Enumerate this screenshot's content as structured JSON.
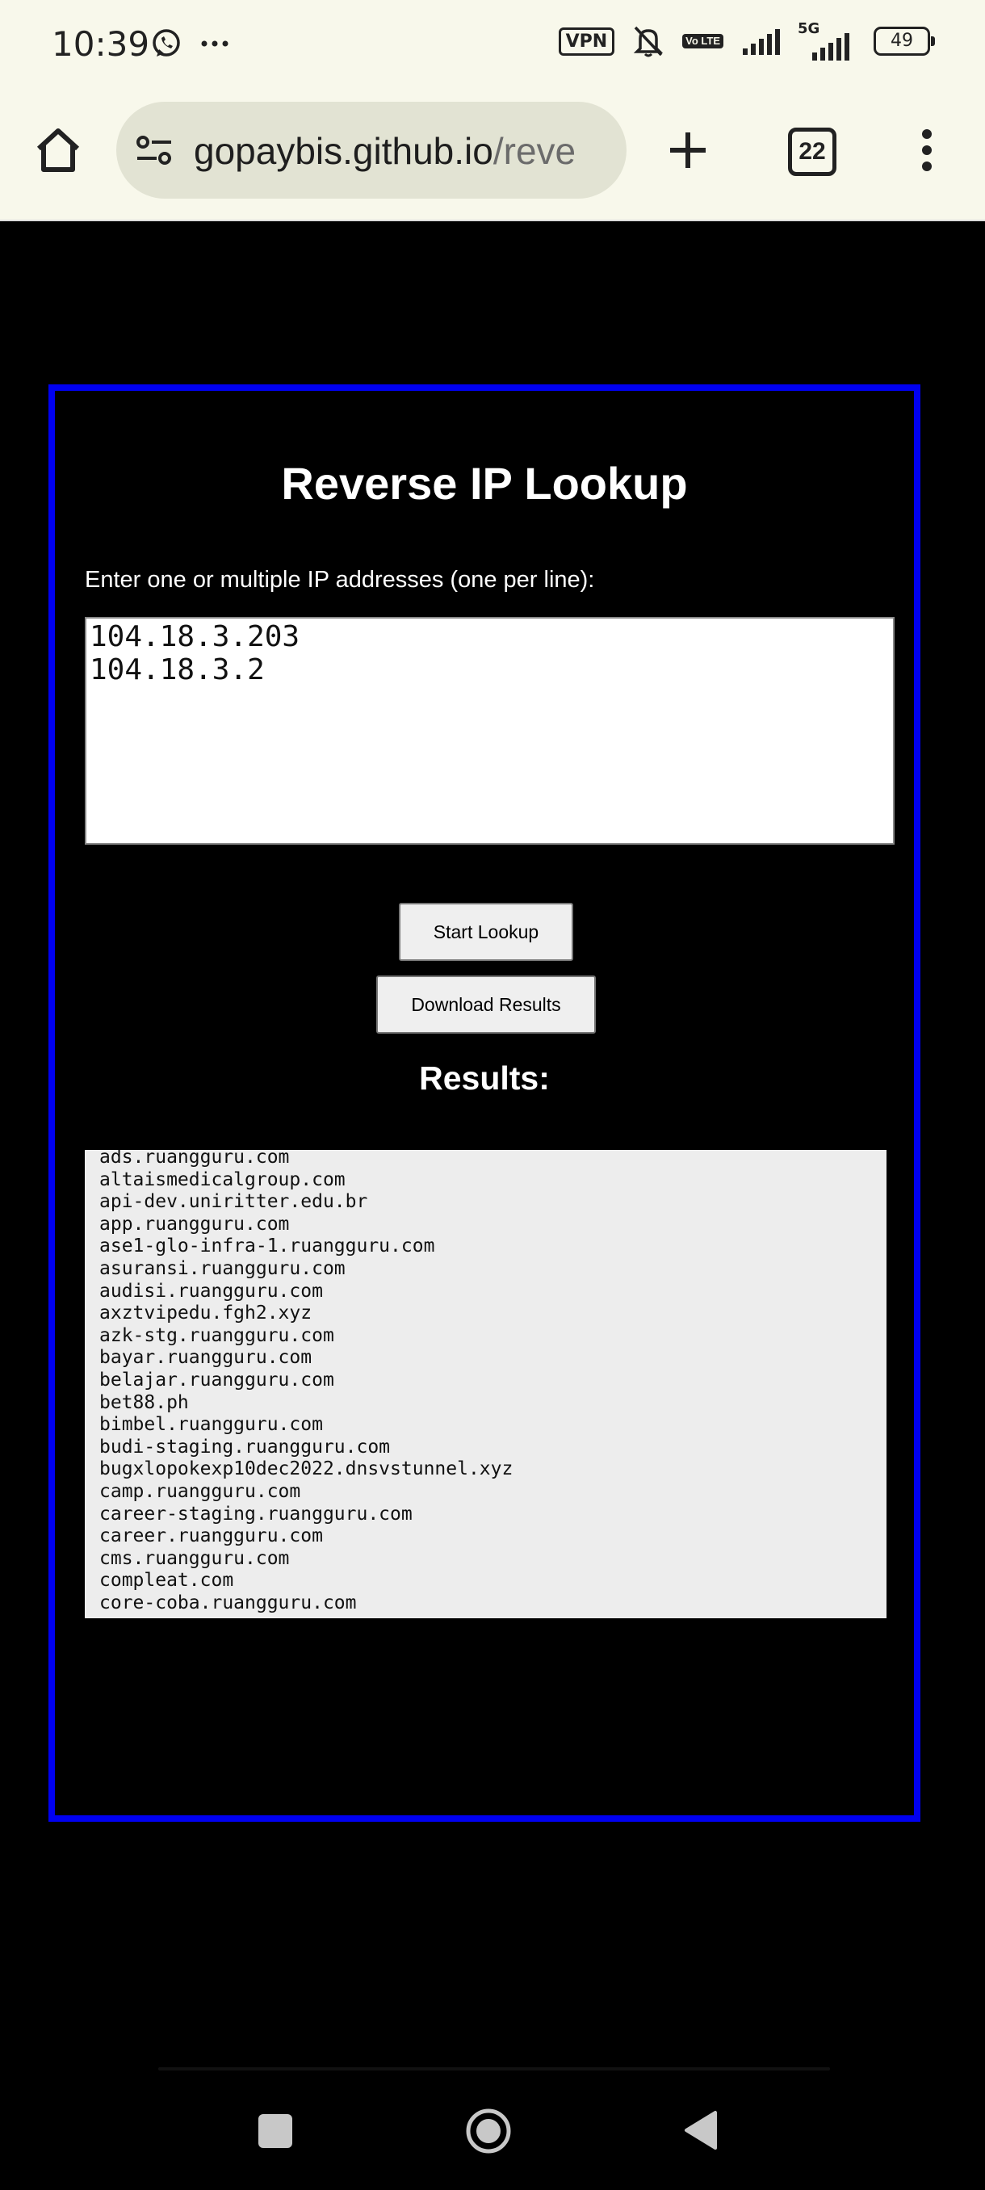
{
  "status_bar": {
    "time": "10:39",
    "left_icons": [
      "whatsapp-icon",
      "more-dots-icon"
    ],
    "vpn": "VPN",
    "volte": "Vo LTE",
    "network": "5G",
    "battery": "49"
  },
  "browser": {
    "url_host": "gopaybis.github.io",
    "url_path": "/reve",
    "tab_count": "22"
  },
  "page": {
    "title": "Reverse IP Lookup",
    "input_label": "Enter one or multiple IP addresses (one per line):",
    "ip_input_value": "104.18.3.203\n104.18.3.2",
    "start_button": "Start Lookup",
    "download_button": "Download Results",
    "results_title": "Results:",
    "results": [
      "ads.ruangguru.com",
      "altaismedicalgroup.com",
      "api-dev.uniritter.edu.br",
      "app.ruangguru.com",
      "ase1-glo-infra-1.ruangguru.com",
      "asuransi.ruangguru.com",
      "audisi.ruangguru.com",
      "axztvipedu.fgh2.xyz",
      "azk-stg.ruangguru.com",
      "bayar.ruangguru.com",
      "belajar.ruangguru.com",
      "bet88.ph",
      "bimbel.ruangguru.com",
      "budi-staging.ruangguru.com",
      "bugxlopokexp10dec2022.dnsvstunnel.xyz",
      "camp.ruangguru.com",
      "career-staging.ruangguru.com",
      "career.ruangguru.com",
      "cms.ruangguru.com",
      "compleat.com",
      "core-coba.ruangguru.com"
    ]
  },
  "colors": {
    "container_border": "#0000f0",
    "page_background": "#000000",
    "chrome_background": "#f8f8eb",
    "url_pill": "#e2e3d3",
    "results_background": "#ededed"
  }
}
